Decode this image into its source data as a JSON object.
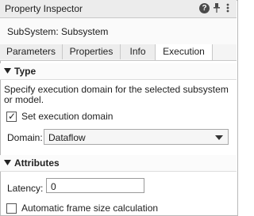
{
  "panel": {
    "title": "Property Inspector"
  },
  "header": {
    "subsystem_label": "SubSystem: Subsystem"
  },
  "tabs": [
    {
      "label": "Parameters"
    },
    {
      "label": "Properties"
    },
    {
      "label": "Info"
    },
    {
      "label": "Execution"
    }
  ],
  "execution": {
    "section_type": "Type",
    "description": "Specify execution domain for the selected subsystem or model.",
    "set_domain_label": "Set execution domain",
    "set_domain_checked": true,
    "domain_label": "Domain:",
    "domain_value": "Dataflow"
  },
  "attributes": {
    "section_title": "Attributes",
    "latency_label": "Latency:",
    "latency_value": "0",
    "auto_frame_label": "Automatic frame size calculation",
    "auto_frame_checked": false
  },
  "colors": {
    "title_bg": "#ececec",
    "active_tab_bg": "#ffffff",
    "inactive_tab_bg": "#ededed"
  }
}
